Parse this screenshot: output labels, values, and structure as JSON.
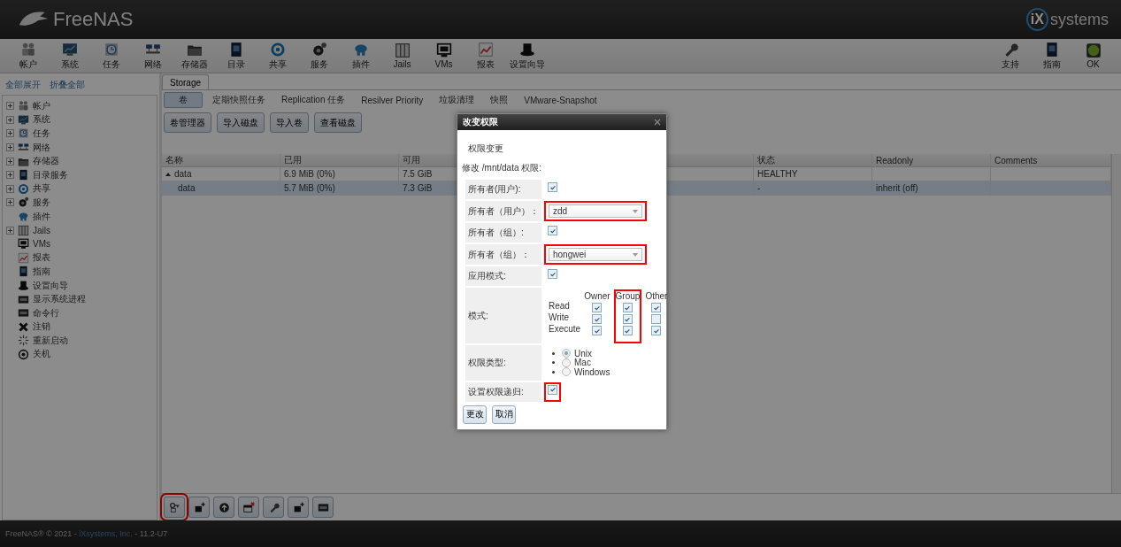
{
  "header": {
    "brand": "FreeNAS",
    "vendor_mark": "iX",
    "vendor_name": "systems"
  },
  "toolbar": {
    "left": [
      {
        "label": "帐户"
      },
      {
        "label": "系统"
      },
      {
        "label": "任务"
      },
      {
        "label": "网络"
      },
      {
        "label": "存储器"
      },
      {
        "label": "目录"
      },
      {
        "label": "共享"
      },
      {
        "label": "服务"
      },
      {
        "label": "插件"
      },
      {
        "label": "Jails"
      },
      {
        "label": "VMs"
      },
      {
        "label": "报表"
      },
      {
        "label": "设置向导"
      }
    ],
    "right": [
      {
        "label": "支持"
      },
      {
        "label": "指南"
      },
      {
        "label": "OK"
      }
    ]
  },
  "sidebar": {
    "actions": [
      "全部展开",
      "折叠全部"
    ],
    "items": [
      {
        "label": "帐户",
        "expanded": false
      },
      {
        "label": "系统",
        "expanded": false
      },
      {
        "label": "任务",
        "expanded": false
      },
      {
        "label": "网络",
        "expanded": false
      },
      {
        "label": "存储器",
        "expanded": false
      },
      {
        "label": "目录服务",
        "expanded": false
      },
      {
        "label": "共享",
        "expanded": false
      },
      {
        "label": "服务",
        "expanded": false
      },
      {
        "label": "插件"
      },
      {
        "label": "Jails",
        "expanded": false
      },
      {
        "label": "VMs"
      },
      {
        "label": "报表"
      },
      {
        "label": "指南"
      },
      {
        "label": "设置向导"
      },
      {
        "label": "显示系统进程"
      },
      {
        "label": "命令行"
      },
      {
        "label": "注销"
      },
      {
        "label": "重新启动"
      },
      {
        "label": "关机"
      }
    ]
  },
  "tabs": [
    {
      "label": "Storage",
      "selected": true
    }
  ],
  "subtabs": [
    {
      "label": "卷",
      "selected": true
    },
    {
      "label": "定期快照任务",
      "selected": false
    },
    {
      "label": "Replication 任务",
      "selected": false
    },
    {
      "label": "Resilver Priority",
      "selected": false
    },
    {
      "label": "垃圾清理",
      "selected": false
    },
    {
      "label": "快照",
      "selected": false
    },
    {
      "label": "VMware-Snapshot",
      "selected": false
    }
  ],
  "actions": [
    "卷管理器",
    "导入磁盘",
    "导入卷",
    "查看磁盘"
  ],
  "table": {
    "columns": [
      "名称",
      "已用",
      "可用",
      "状态",
      "Readonly",
      "Comments"
    ],
    "rows": [
      {
        "name": "data",
        "used": "6.9 MiB (0%)",
        "available": "7.5 GiB",
        "status": "HEALTHY",
        "expanded": true,
        "selected": false,
        "children": [
          {
            "name": "data",
            "used": "5.7 MiB (0%)",
            "available": "7.3 GiB",
            "status": "-",
            "readonly": "inherit (off)",
            "selected": true
          }
        ]
      }
    ]
  },
  "bottom_buttons": [
    {
      "highlight": true
    },
    {
      "highlight": false
    },
    {
      "highlight": false
    },
    {
      "highlight": false
    },
    {
      "highlight": false
    },
    {
      "highlight": false
    },
    {
      "highlight": false
    }
  ],
  "footer": {
    "prefix": "FreeNAS® © 2021 - ",
    "link": "iXsystems, Inc.",
    "suffix": " - 11.2-U7"
  },
  "dialog": {
    "title": "改变权限",
    "section": "权限变更",
    "caption": "修改 /mnt/data 权限:",
    "fields": [
      {
        "kind": "checkbox",
        "label": "所有者(用户):",
        "checked": true,
        "highlight": false
      },
      {
        "kind": "select",
        "label": "所有者（用户）：",
        "value": "zdd",
        "highlight": true
      },
      {
        "kind": "checkbox",
        "label": "所有者（组）:",
        "checked": true,
        "highlight": false
      },
      {
        "kind": "select",
        "label": "所有者（组）：",
        "value": "hongwei",
        "highlight": true
      },
      {
        "kind": "checkbox",
        "label": "应用模式:",
        "checked": true,
        "highlight": false
      },
      {
        "kind": "mode",
        "label": "模式:",
        "columns": [
          {
            "label": "Owner",
            "highlight": false
          },
          {
            "label": "Group",
            "highlight": true
          },
          {
            "label": "Other",
            "highlight": false
          }
        ],
        "rows": [
          {
            "label": "Read",
            "checks": [
              true,
              true,
              true
            ]
          },
          {
            "label": "Write",
            "checks": [
              true,
              true,
              false
            ]
          },
          {
            "label": "Execute",
            "checks": [
              true,
              true,
              true
            ]
          }
        ]
      },
      {
        "kind": "radio",
        "label": "权限类型:",
        "options": [
          {
            "label": "Unix",
            "selected": true
          },
          {
            "label": "Mac",
            "selected": false
          },
          {
            "label": "Windows",
            "selected": false
          }
        ]
      },
      {
        "kind": "checkbox",
        "label": "设置权限递归:",
        "checked": true,
        "highlight": true
      }
    ],
    "buttons": [
      "更改",
      "取消"
    ]
  }
}
